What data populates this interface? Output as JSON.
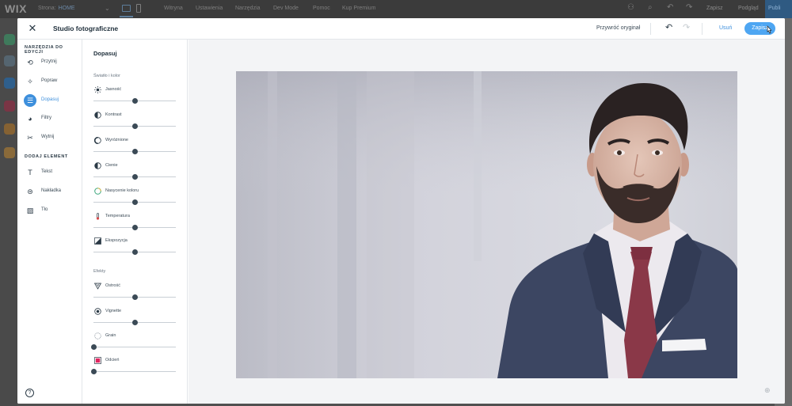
{
  "topbar": {
    "logo": "WIX",
    "page_selector_label": "Strona:",
    "page_selector_value": "HOME",
    "menu": [
      "Witryna",
      "Ustawienia",
      "Narzędzia",
      "Dev Mode",
      "Pomoc",
      "Kup Premium"
    ],
    "save_label": "Zapisz",
    "preview_label": "Podgląd",
    "publish_label": "Publi"
  },
  "modal": {
    "title": "Studio fotograficzne",
    "revert_label": "Przywróć oryginał",
    "remove_label": "Usuń",
    "save_label": "Zapisz"
  },
  "tools": {
    "edit_section": "NARZĘDZIA DO EDYCJI",
    "edit_items": [
      {
        "label": "Przytnij",
        "icon": "crop-icon"
      },
      {
        "label": "Popraw",
        "icon": "magic-wand-icon"
      },
      {
        "label": "Dopasuj",
        "icon": "sliders-icon"
      },
      {
        "label": "Filtry",
        "icon": "filters-icon"
      },
      {
        "label": "Wytnij",
        "icon": "scissors-icon"
      }
    ],
    "add_section": "DODAJ ELEMENT",
    "add_items": [
      {
        "label": "Tekst",
        "icon": "text-icon"
      },
      {
        "label": "Nakładka",
        "icon": "overlay-icon"
      },
      {
        "label": "Tło",
        "icon": "background-icon"
      }
    ],
    "active_item": "Dopasuj"
  },
  "adjust": {
    "title": "Dopasuj",
    "light_section": "Światło i kolor",
    "light_sliders": [
      {
        "label": "Jasność",
        "icon": "brightness-icon",
        "value": 0.5
      },
      {
        "label": "Kontrast",
        "icon": "contrast-icon",
        "value": 0.5
      },
      {
        "label": "Wyróżnione",
        "icon": "highlights-icon",
        "value": 0.5
      },
      {
        "label": "Cienie",
        "icon": "shadows-icon",
        "value": 0.5
      },
      {
        "label": "Nasycenie koloru",
        "icon": "saturation-icon",
        "value": 0.5
      },
      {
        "label": "Temperatura",
        "icon": "thermometer-icon",
        "value": 0.5
      },
      {
        "label": "Ekspozycja",
        "icon": "exposure-icon",
        "value": 0.5
      }
    ],
    "effects_section": "Efekty",
    "effect_sliders": [
      {
        "label": "Ostrość",
        "icon": "sharpen-icon",
        "value": 0.5
      },
      {
        "label": "Vignette",
        "icon": "vignette-icon",
        "value": 0.5
      },
      {
        "label": "Grain",
        "icon": "grain-icon",
        "value": 0.0
      },
      {
        "label": "Odcień",
        "icon": "tint-icon",
        "value": 0.0,
        "swatch": "#e0245e"
      }
    ]
  },
  "colors": {
    "accent": "#3d8fdc",
    "save_button": "#4ea6f2",
    "publish": "#2f5a82"
  }
}
